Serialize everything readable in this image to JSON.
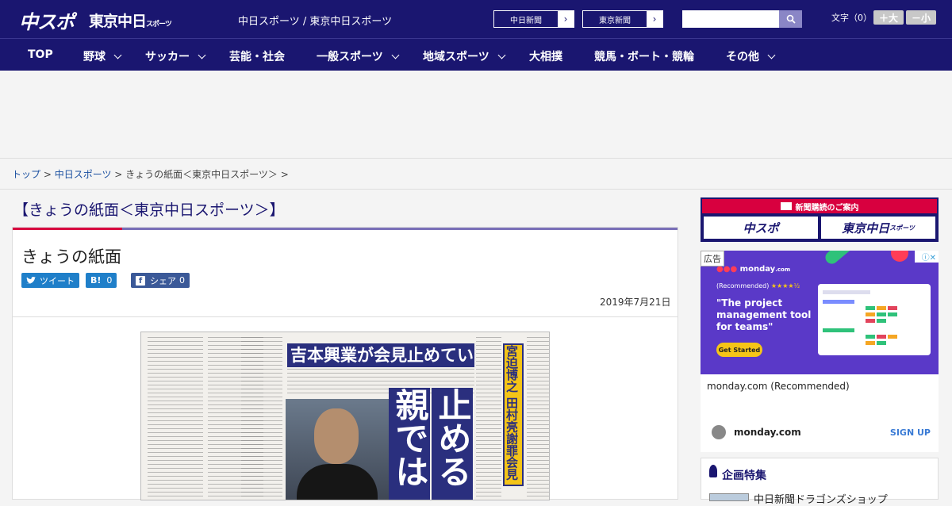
{
  "header": {
    "logo_left": "中スポ",
    "logo_right": "東京中日",
    "logo_right_small": "スポーツ",
    "site_title": "中日スポーツ / 東京中日スポーツ",
    "link_chunichi": "中日新聞",
    "link_tokyo": "東京新聞",
    "font_label": "文字（0）",
    "font_larger": "＋大",
    "font_smaller": "－小",
    "arrow": "›"
  },
  "nav": {
    "items": [
      "TOP",
      "野球",
      "サッカー",
      "芸能・社会",
      "一般スポーツ",
      "地域スポーツ",
      "大相撲",
      "競馬・ボート・競輪",
      "その他"
    ]
  },
  "breadcrumb": {
    "top": "トップ",
    "sep": " > ",
    "chunichi": "中日スポーツ",
    "current": "きょうの紙面＜東京中日スポーツ＞ >"
  },
  "section_title": "【きょうの紙面＜東京中日スポーツ＞】",
  "article": {
    "title": "きょうの紙面",
    "tweet_label": "ツイート",
    "hatena_label": "B!",
    "hatena_count": "0",
    "share_label": "シェア",
    "share_count": "0",
    "date": "2019年7月21日"
  },
  "paper": {
    "headline": "吉本興業が会見止めていた",
    "big_text_1": "止めるのは",
    "big_text_2": "親ではない",
    "vertical": "宮迫博之 田村亮謝罪会見"
  },
  "sidebar": {
    "banner_title": "新聞購読のご案内",
    "banner_left": "中スポ",
    "banner_right": "東京中日",
    "banner_right_small": "スポーツ"
  },
  "ad": {
    "tag": "広告",
    "close": "ⓘ✕",
    "brand": "monday",
    "brand_suffix": ".com",
    "recommended": "(Recommended)",
    "stars": "★★★★½",
    "headline": "\"The project management tool for teams\"",
    "cta": "Get Started",
    "name": "monday.com (Recommended)",
    "site": "monday.com",
    "signup": "SIGN UP"
  },
  "feature": {
    "title": "企画特集",
    "item": "中日新聞ドラゴンズショップ"
  },
  "colors": {
    "navy": "#1a1670",
    "red": "#d8003f",
    "purple": "#7a6fb8"
  }
}
